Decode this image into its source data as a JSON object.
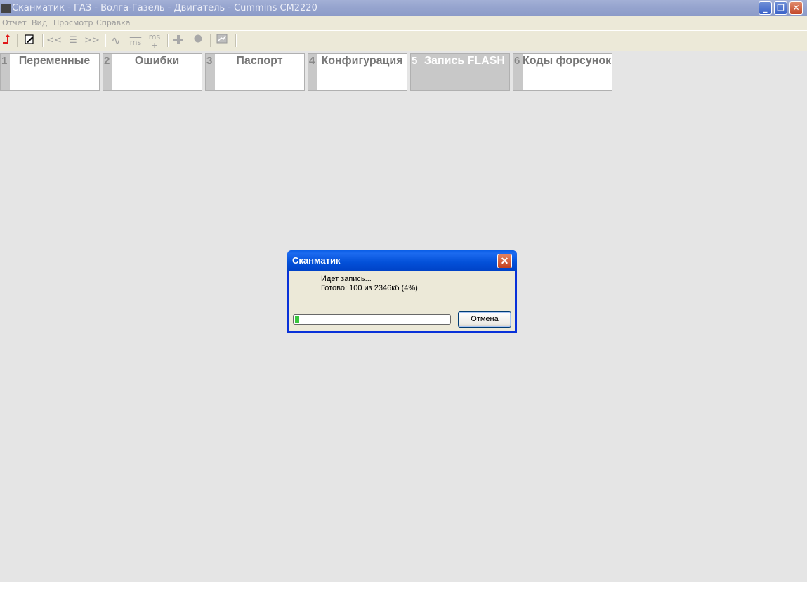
{
  "window": {
    "title": "Сканматик - ГАЗ - Волга-Газель - Двигатель - Cummins CM2220",
    "min_glyph": "_",
    "max_glyph": "❐",
    "close_glyph": "✕"
  },
  "menu": {
    "items": [
      "Отчет",
      "Вид",
      "Просмотр",
      "Справка"
    ]
  },
  "toolbar": {
    "back_glyph": "<<",
    "list_glyph": "☰",
    "forward_glyph": ">>",
    "wave_glyph": "∿",
    "ms_minus": "ms",
    "ms_plus": "ms"
  },
  "tabs": [
    {
      "num": "1",
      "label": "Переменные",
      "active": false
    },
    {
      "num": "2",
      "label": "Ошибки",
      "active": false
    },
    {
      "num": "3",
      "label": "Паспорт",
      "active": false
    },
    {
      "num": "4",
      "label": "Конфигурация",
      "active": false
    },
    {
      "num": "5",
      "label": "Запись FLASH",
      "active": true
    },
    {
      "num": "6",
      "label": "Коды форсунок",
      "active": false
    }
  ],
  "dialog": {
    "title": "Сканматик",
    "close_glyph": "✕",
    "line1": "Идет запись...",
    "line2": "Готово: 100 из 2346кб (4%)",
    "progress_percent": 4,
    "cancel_label": "Отмена"
  },
  "colors": {
    "accent": "#0831d9",
    "progress": "#39c63e",
    "workspace": "#e5e5e5"
  }
}
